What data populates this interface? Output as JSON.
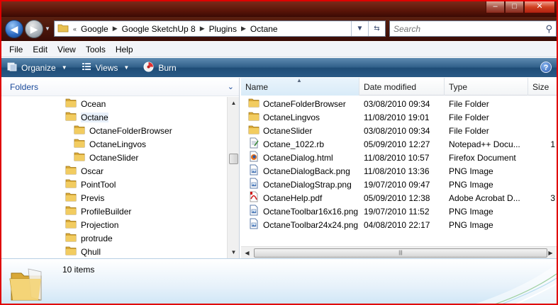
{
  "window": {
    "buttons": {
      "minimize": "–",
      "maximize": "□",
      "close": "✕"
    }
  },
  "nav": {
    "back_icon": "arrow-left-icon",
    "forward_icon": "arrow-right-icon",
    "breadcrumb_overflow": "«",
    "breadcrumbs": [
      "Google",
      "Google SketchUp 8",
      "Plugins",
      "Octane"
    ],
    "refresh_icon": "refresh-icon"
  },
  "search": {
    "placeholder": "Search"
  },
  "menubar": [
    "File",
    "Edit",
    "View",
    "Tools",
    "Help"
  ],
  "commandbar": {
    "organize": "Organize",
    "views": "Views",
    "burn": "Burn",
    "help": "?"
  },
  "leftpane": {
    "header": "Folders",
    "tree": [
      {
        "label": "Ocean",
        "level": 0
      },
      {
        "label": "Octane",
        "level": 0,
        "selected": true
      },
      {
        "label": "OctaneFolderBrowser",
        "level": 1
      },
      {
        "label": "OctaneLingvos",
        "level": 1
      },
      {
        "label": "OctaneSlider",
        "level": 1
      },
      {
        "label": "Oscar",
        "level": 0
      },
      {
        "label": "PointTool",
        "level": 0
      },
      {
        "label": "Previs",
        "level": 0
      },
      {
        "label": "ProfileBuilder",
        "level": 0
      },
      {
        "label": "Projection",
        "level": 0
      },
      {
        "label": "protrude",
        "level": 0
      },
      {
        "label": "Qhull",
        "level": 0
      }
    ]
  },
  "filelist": {
    "columns": [
      "Name",
      "Date modified",
      "Type",
      "Size"
    ],
    "rows": [
      {
        "name": "OctaneFolderBrowser",
        "date": "03/08/2010 09:34",
        "type": "File Folder",
        "size": "",
        "icon": "folder-icon"
      },
      {
        "name": "OctaneLingvos",
        "date": "11/08/2010 19:01",
        "type": "File Folder",
        "size": "",
        "icon": "folder-icon"
      },
      {
        "name": "OctaneSlider",
        "date": "03/08/2010 09:34",
        "type": "File Folder",
        "size": "",
        "icon": "folder-icon"
      },
      {
        "name": "Octane_1022.rb",
        "date": "05/09/2010 12:27",
        "type": "Notepad++ Docu...",
        "size": "1",
        "icon": "text-file-icon"
      },
      {
        "name": "OctaneDialog.html",
        "date": "11/08/2010 10:57",
        "type": "Firefox Document",
        "size": "",
        "icon": "firefox-document-icon"
      },
      {
        "name": "OctaneDialogBack.png",
        "date": "11/08/2010 13:36",
        "type": "PNG Image",
        "size": "",
        "icon": "image-file-icon"
      },
      {
        "name": "OctaneDialogStrap.png",
        "date": "19/07/2010 09:47",
        "type": "PNG Image",
        "size": "",
        "icon": "image-file-icon"
      },
      {
        "name": "OctaneHelp.pdf",
        "date": "05/09/2010 12:38",
        "type": "Adobe Acrobat D...",
        "size": "3",
        "icon": "pdf-file-icon"
      },
      {
        "name": "OctaneToolbar16x16.png",
        "date": "19/07/2010 11:52",
        "type": "PNG Image",
        "size": "",
        "icon": "image-file-icon"
      },
      {
        "name": "OctaneToolbar24x24.png",
        "date": "04/08/2010 22:17",
        "type": "PNG Image",
        "size": "",
        "icon": "image-file-icon"
      }
    ]
  },
  "details": {
    "count": "10 items"
  },
  "colors": {
    "frame": "#e00000",
    "commandbar": "#2e5e88",
    "folder_header": "#1a4a9a"
  }
}
